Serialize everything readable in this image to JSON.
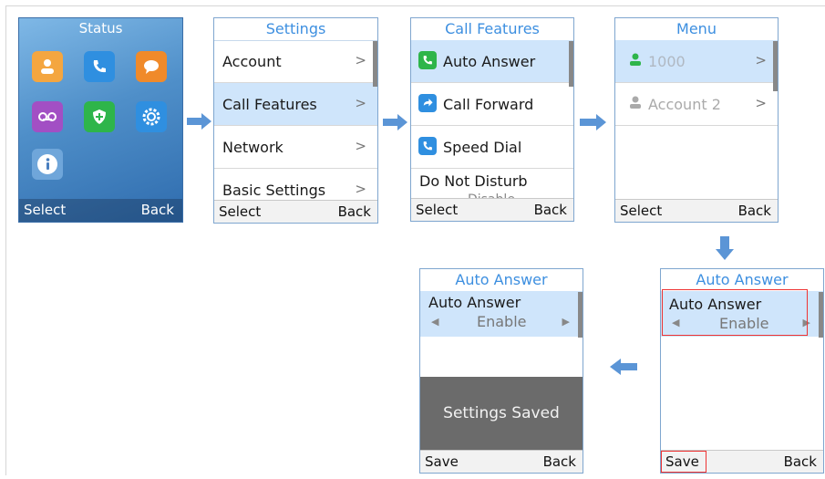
{
  "status": {
    "title": "Status",
    "select": "Select",
    "back": "Back",
    "apps": [
      "contacts-icon",
      "call-history-icon",
      "messages-icon",
      "voicemail-icon",
      "security-icon",
      "settings-gear-icon",
      "info-icon"
    ]
  },
  "settings": {
    "title": "Settings",
    "items": [
      "Account",
      "Call Features",
      "Network",
      "Basic Settings"
    ],
    "select": "Select",
    "back": "Back"
  },
  "callfeatures": {
    "title": "Call Features",
    "items": [
      "Auto Answer",
      "Call Forward",
      "Speed Dial",
      "Do Not Disturb"
    ],
    "dnd_value": "Disable",
    "select": "Select",
    "back": "Back"
  },
  "menu": {
    "title": "Menu",
    "items": [
      "1000",
      "Account 2"
    ],
    "select": "Select",
    "back": "Back"
  },
  "autoanswer_edit": {
    "title": "Auto Answer",
    "label": "Auto Answer",
    "value": "Enable",
    "save": "Save",
    "back": "Back"
  },
  "autoanswer_saved": {
    "title": "Auto Answer",
    "label": "Auto Answer",
    "value": "Enable",
    "toast": "Settings Saved",
    "save": "Save",
    "back": "Back"
  },
  "colors": {
    "accent": "#3d8fe0",
    "selected_row": "#cfe5fb",
    "arrow": "#5b95d6",
    "highlight_box": "#e33333",
    "toast_bg": "#6b6b6b"
  }
}
